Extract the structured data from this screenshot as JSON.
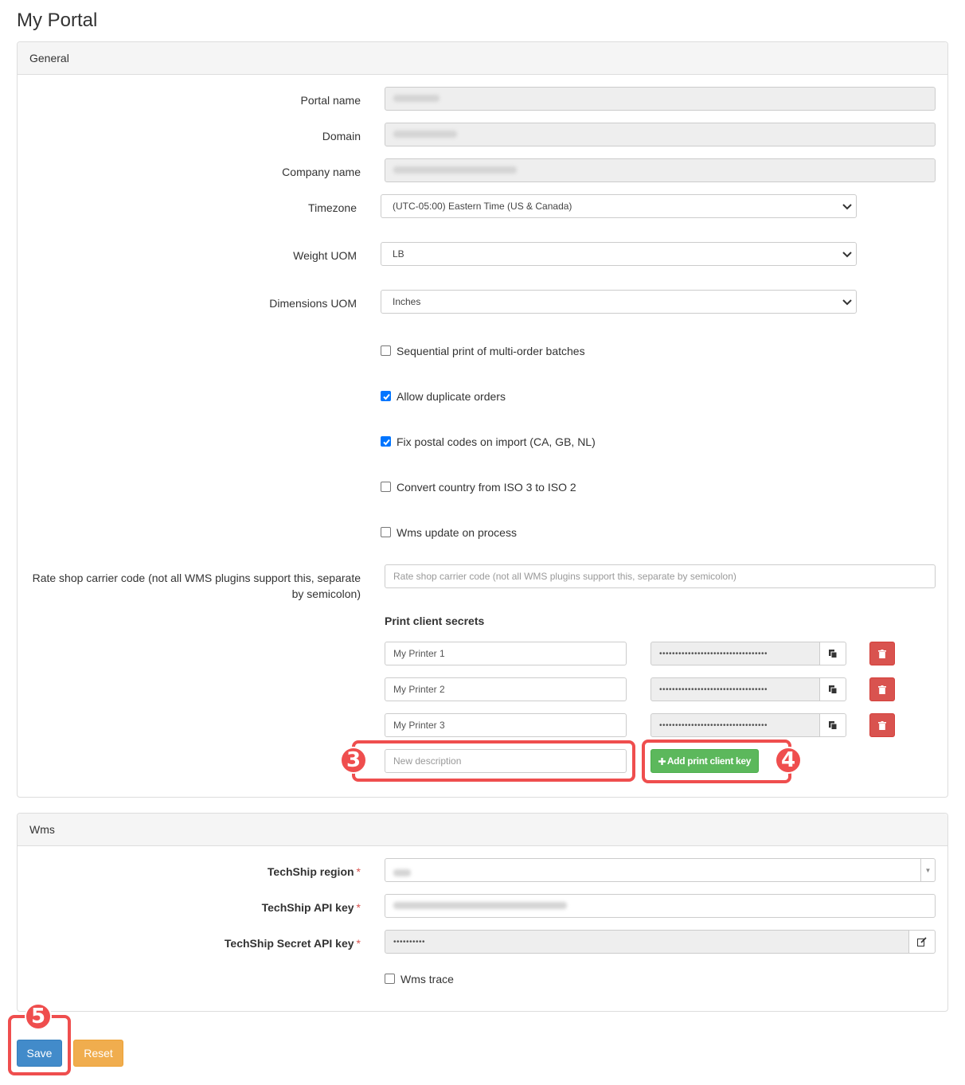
{
  "page": {
    "title": "My Portal"
  },
  "general": {
    "heading": "General",
    "fields": {
      "portal_name": {
        "label": "Portal name"
      },
      "domain": {
        "label": "Domain"
      },
      "company_name": {
        "label": "Company name"
      },
      "timezone": {
        "label": "Timezone",
        "value": "(UTC-05:00) Eastern Time (US & Canada)"
      },
      "weight_uom": {
        "label": "Weight UOM",
        "value": "LB"
      },
      "dimensions_uom": {
        "label": "Dimensions UOM",
        "value": "Inches"
      }
    },
    "checkboxes": [
      {
        "label": "Sequential print of multi-order batches",
        "checked": false
      },
      {
        "label": "Allow duplicate orders",
        "checked": true
      },
      {
        "label": "Fix postal codes on import (CA, GB, NL)",
        "checked": true
      },
      {
        "label": "Convert country from ISO 3 to ISO 2",
        "checked": false
      },
      {
        "label": "Wms update on process",
        "checked": false
      }
    ],
    "rate_shop": {
      "label_line1": "Rate shop carrier code (not all WMS plugins support this, separate",
      "label_line2": "by semicolon)",
      "placeholder": "Rate shop carrier code (not all WMS plugins support this, separate by semicolon)"
    },
    "print_client": {
      "heading": "Print client secrets",
      "keys": [
        {
          "description": "My Printer 1",
          "secret": "••••••••••••••••••••••••••••••••••"
        },
        {
          "description": "My Printer 2",
          "secret": "••••••••••••••••••••••••••••••••••"
        },
        {
          "description": "My Printer 3",
          "secret": "••••••••••••••••••••••••••••••••••"
        }
      ],
      "new_placeholder": "New description",
      "add_button": "Add print client key",
      "add_icon": "plus-icon"
    }
  },
  "wms": {
    "heading": "Wms",
    "region_label": "TechShip region",
    "api_key_label": "TechShip API key",
    "secret_label": "TechShip Secret API key",
    "secret_value": "••••••••••",
    "required_mark": "*",
    "trace_label": "Wms trace",
    "trace_checked": false
  },
  "actions": {
    "save": "Save",
    "reset": "Reset"
  },
  "annotations": {
    "step3": "3",
    "step4": "4",
    "step5": "5"
  },
  "colors": {
    "primary": "#428bca",
    "warning": "#f0ad4e",
    "success": "#5cb85c",
    "danger": "#d9534f",
    "callout": "#ef4e4e",
    "checkbox": "#0075ff"
  }
}
